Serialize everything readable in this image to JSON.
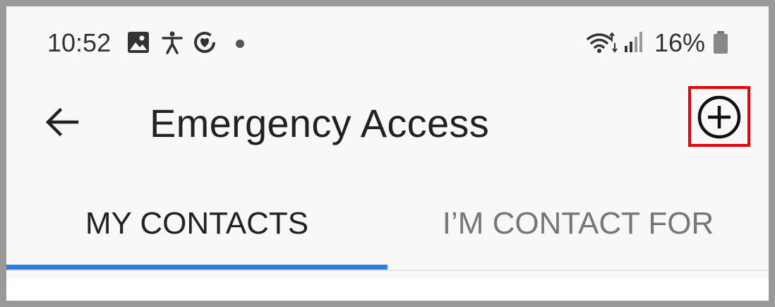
{
  "status_bar": {
    "time": "10:52",
    "battery_percent": "16%",
    "icons": [
      "image-icon",
      "accessibility-icon",
      "heart-circle-icon",
      "notification-dot",
      "wifi-icon",
      "cellular-signal-icon",
      "battery-icon"
    ]
  },
  "toolbar": {
    "title": "Emergency Access",
    "back_icon": "arrow-left-icon",
    "add_icon": "plus-circle-icon",
    "highlight_color": "#e8000b"
  },
  "tabs": [
    {
      "label": "MY CONTACTS",
      "selected": true
    },
    {
      "label": "I’M CONTACT FOR",
      "selected": false
    }
  ],
  "colors": {
    "accent": "#2f7de1",
    "background": "#f8f8f8"
  }
}
